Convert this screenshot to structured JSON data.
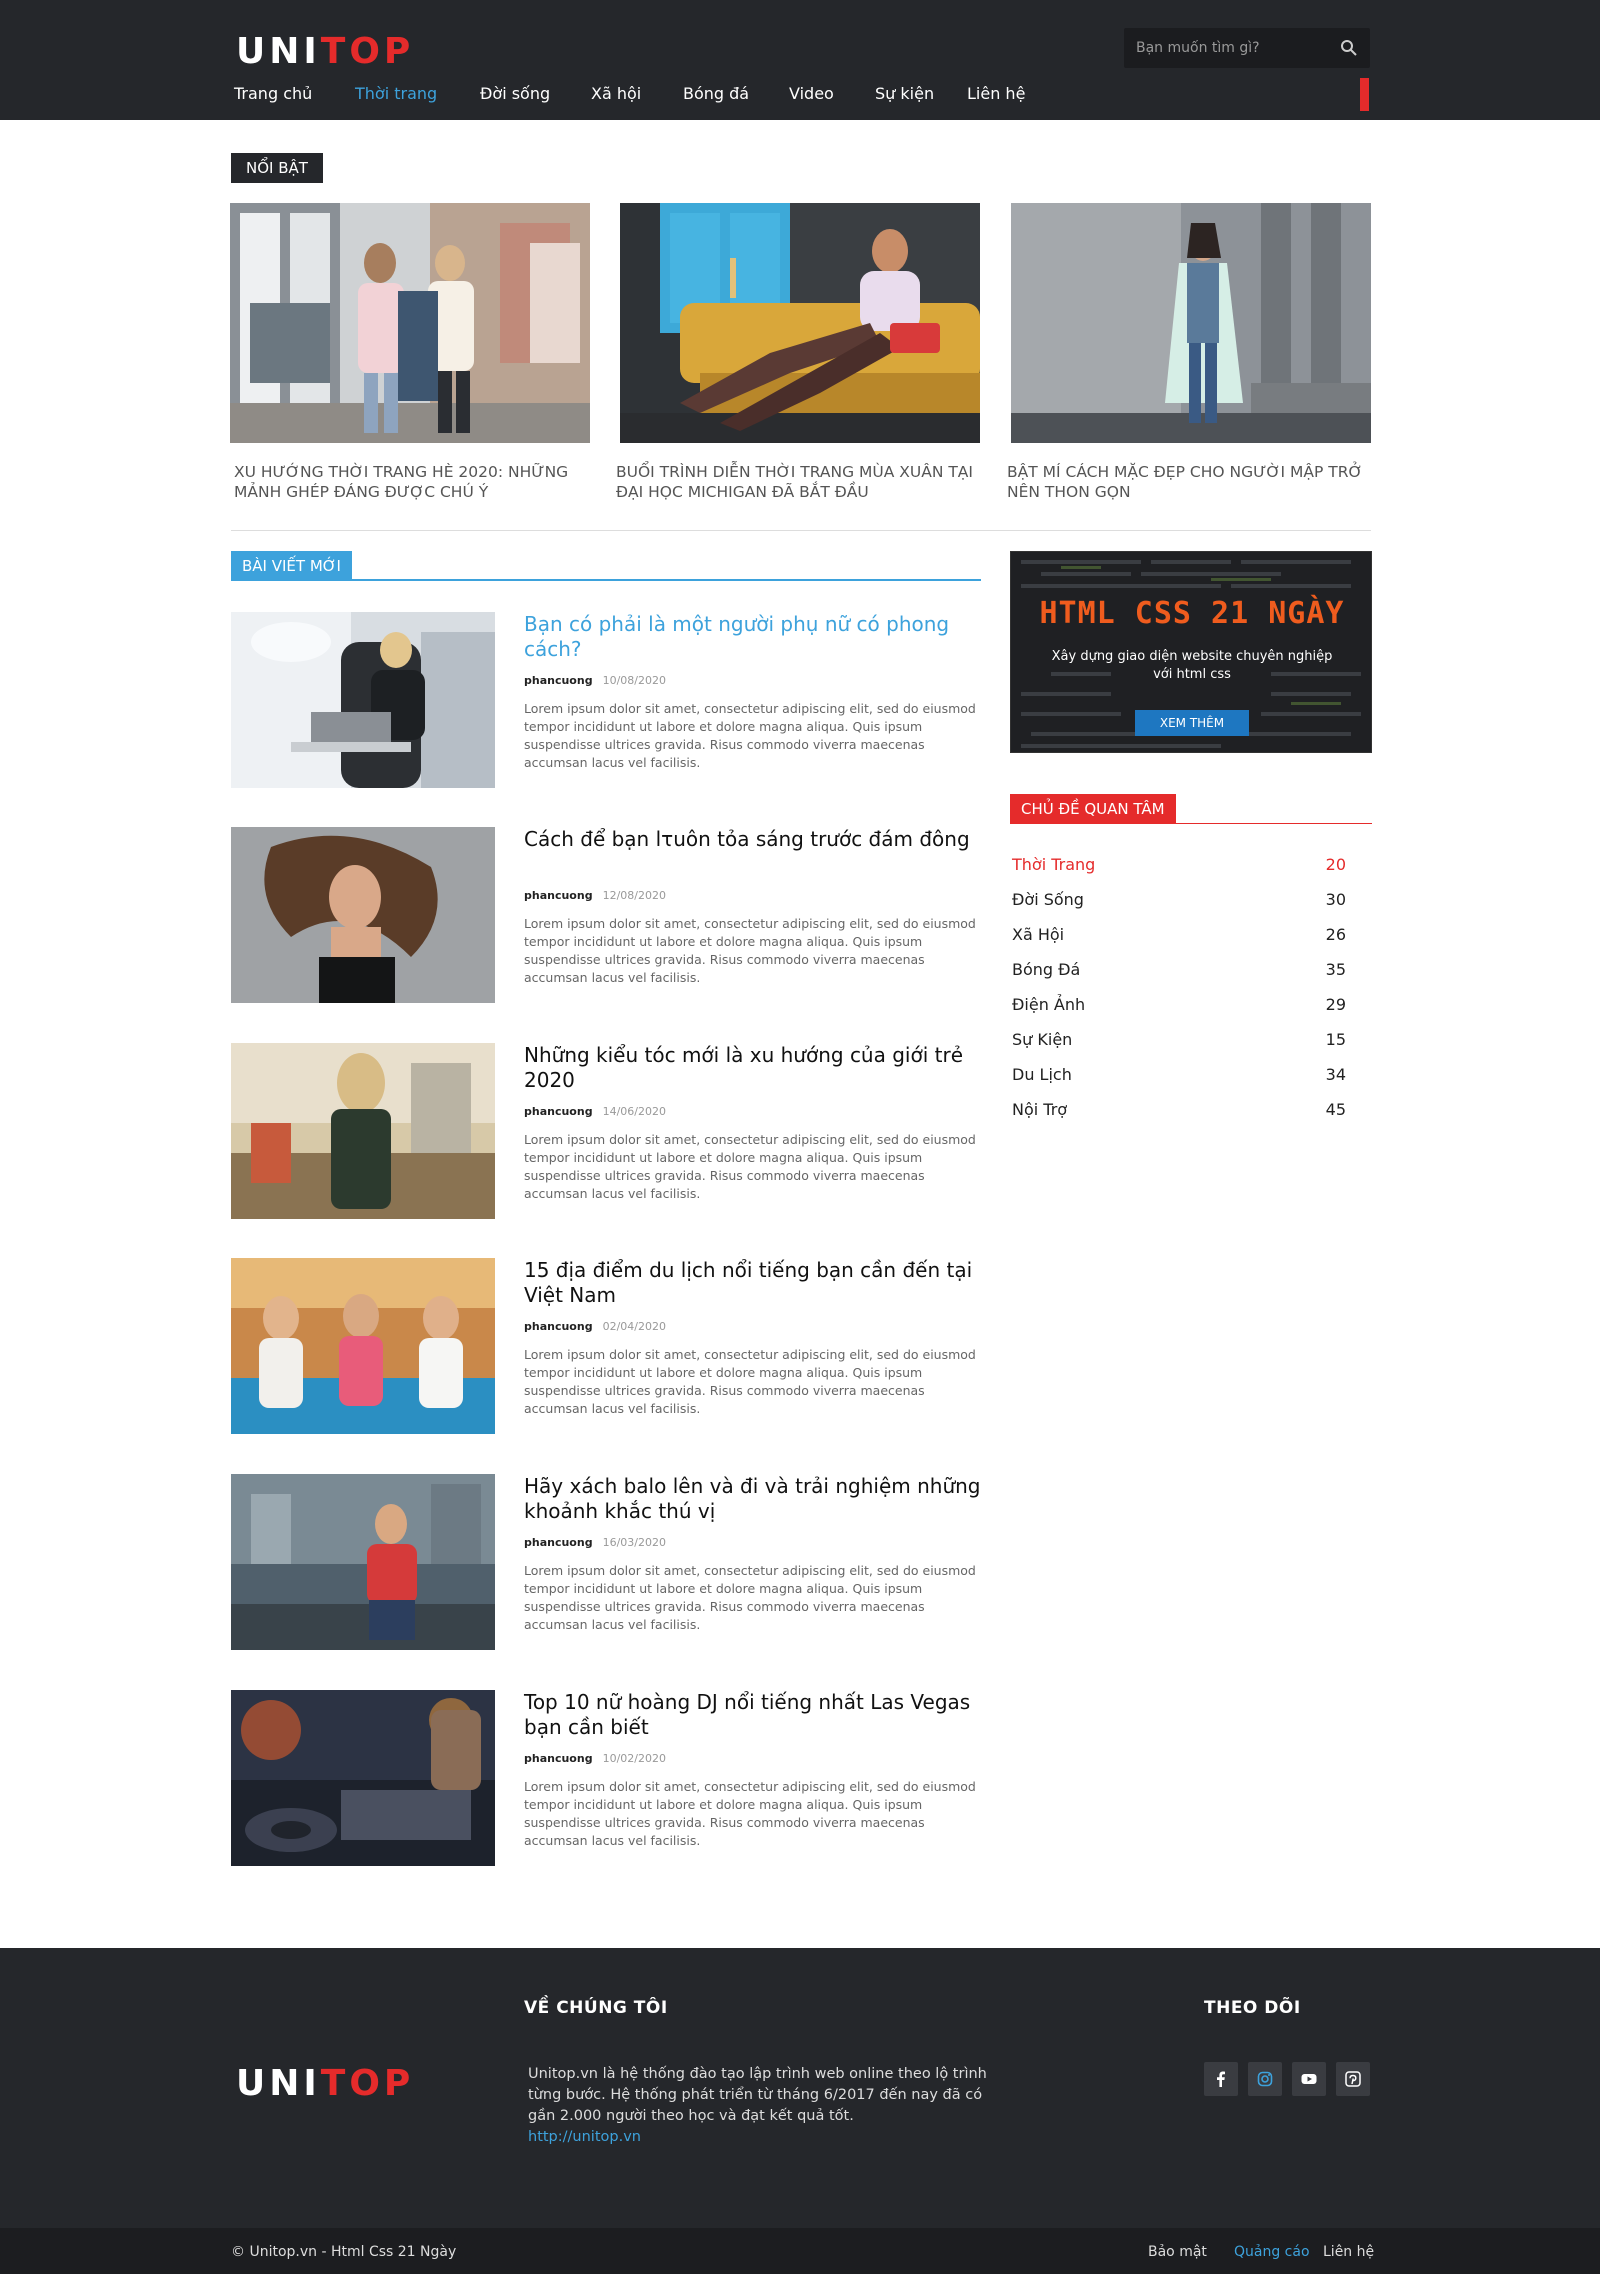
{
  "brand": {
    "logo_left": "UNI",
    "logo_right": "TOP",
    "accent": "#e52b2b",
    "link": "#3da2dc",
    "dark": "#25272b"
  },
  "search": {
    "placeholder": "Bạn muốn tìm gì?",
    "icon": "search-icon"
  },
  "nav": {
    "items": [
      {
        "label": "Trang chủ",
        "active": false
      },
      {
        "label": "Thời trang",
        "active": true
      },
      {
        "label": "Đời sống",
        "active": false
      },
      {
        "label": "Xã hội",
        "active": false
      },
      {
        "label": "Bóng đá",
        "active": false
      },
      {
        "label": "Video",
        "active": false
      },
      {
        "label": "Sự kiện",
        "active": false
      },
      {
        "label": "Liên hệ",
        "active": false
      }
    ]
  },
  "featured": {
    "label": "NỔI BẬT",
    "items": [
      {
        "title": "Xu hướng thời trang hè 2020: Những mảnh ghép đáng được chú ý"
      },
      {
        "title": "Buổi trình diễn thời trang mùa xuân tại Đại học Michigan đã bắt đầu"
      },
      {
        "title": "Bật mí cách mặc đẹp cho người mập trở nên thon gọn"
      }
    ]
  },
  "latest": {
    "label": "BÀI VIẾT MỚI",
    "posts": [
      {
        "title": "Bạn có phải là một người phụ nữ có phong cách?",
        "author": "phancuong",
        "date": "10/08/2020",
        "excerpt": "Lorem ipsum dolor sit amet, consectetur adipiscing elit, sed do eiusmod tempor incididunt ut labore et dolore magna aliqua. Quis ipsum suspendisse ultrices gravida. Risus commodo viverra maecenas accumsan lacus vel facilisis."
      },
      {
        "title": "Cách để bạn lτuôn tỏa sáng trước đám đông",
        "author": "phancuong",
        "date": "12/08/2020",
        "excerpt": "Lorem ipsum dolor sit amet, consectetur adipiscing elit, sed do eiusmod tempor incididunt ut labore et dolore magna aliqua. Quis ipsum suspendisse ultrices gravida. Risus commodo viverra maecenas accumsan lacus vel facilisis."
      },
      {
        "title": "Những kiểu tóc mới là xu hướng của giới trẻ 2020",
        "author": "phancuong",
        "date": "14/06/2020",
        "excerpt": "Lorem ipsum dolor sit amet, consectetur adipiscing elit, sed do eiusmod tempor incididunt ut labore et dolore magna aliqua. Quis ipsum suspendisse ultrices gravida. Risus commodo viverra maecenas accumsan lacus vel facilisis."
      },
      {
        "title": "15 địa điểm du lịch nổi tiếng bạn cần đến tại Việt Nam",
        "author": "phancuong",
        "date": "02/04/2020",
        "excerpt": "Lorem ipsum dolor sit amet, consectetur adipiscing elit, sed do eiusmod tempor incididunt ut labore et dolore magna aliqua. Quis ipsum suspendisse ultrices gravida. Risus commodo viverra maecenas accumsan lacus vel facilisis."
      },
      {
        "title": "Hãy xách balo lên và đi và trải nghiệm những khoảnh khắc thú vị",
        "author": "phancuong",
        "date": "16/03/2020",
        "excerpt": "Lorem ipsum dolor sit amet, consectetur adipiscing elit, sed do eiusmod tempor incididunt ut labore et dolore magna aliqua. Quis ipsum suspendisse ultrices gravida. Risus commodo viverra maecenas accumsan lacus vel facilisis."
      },
      {
        "title": "Top 10 nữ hoàng DJ nổi tiếng nhất Las Vegas bạn cần biết",
        "author": "phancuong",
        "date": "10/02/2020",
        "excerpt": "Lorem ipsum dolor sit amet, consectetur adipiscing elit, sed do eiusmod tempor incididunt ut labore et dolore magna aliqua. Quis ipsum suspendisse ultrices gravida. Risus commodo viverra maecenas accumsan lacus vel facilisis."
      }
    ]
  },
  "banner": {
    "title": "HTML CSS 21 NGÀY",
    "subtitle": "Xây dựng giao diện website chuyên nghiệp với html css",
    "button": "XEM THÊM"
  },
  "topics": {
    "label": "CHỦ ĐỀ QUAN TÂM",
    "items": [
      {
        "name": "Thời Trang",
        "count": "20",
        "active": true
      },
      {
        "name": "Đời Sống",
        "count": "30",
        "active": false
      },
      {
        "name": "Xã Hội",
        "count": "26",
        "active": false
      },
      {
        "name": "Bóng Đá",
        "count": "35",
        "active": false
      },
      {
        "name": "Điện Ảnh",
        "count": "29",
        "active": false
      },
      {
        "name": "Sự Kiện",
        "count": "15",
        "active": false
      },
      {
        "name": "Du Lịch",
        "count": "34",
        "active": false
      },
      {
        "name": "Nội Trợ",
        "count": "45",
        "active": false
      }
    ]
  },
  "footer": {
    "about_heading": "VỀ CHÚNG TÔI",
    "about_text": "Unitop.vn là hệ thống đào tạo lập trình web online theo lộ trình từng bước. Hệ thống phát triển từ tháng 6/2017 đến nay đã có gần 2.000 người theo học và đạt kết quả tốt.",
    "about_link": "http://unitop.vn",
    "follow_heading": "THEO DÕI",
    "social": [
      "facebook-icon",
      "instagram-icon",
      "youtube-icon",
      "pinterest-icon"
    ],
    "copyright": "© Unitop.vn - Html Css 21 Ngày",
    "links": [
      {
        "label": "Bảo mật",
        "active": false
      },
      {
        "label": "Quảng cáo",
        "active": true
      },
      {
        "label": "Liên hệ",
        "active": false
      }
    ]
  }
}
